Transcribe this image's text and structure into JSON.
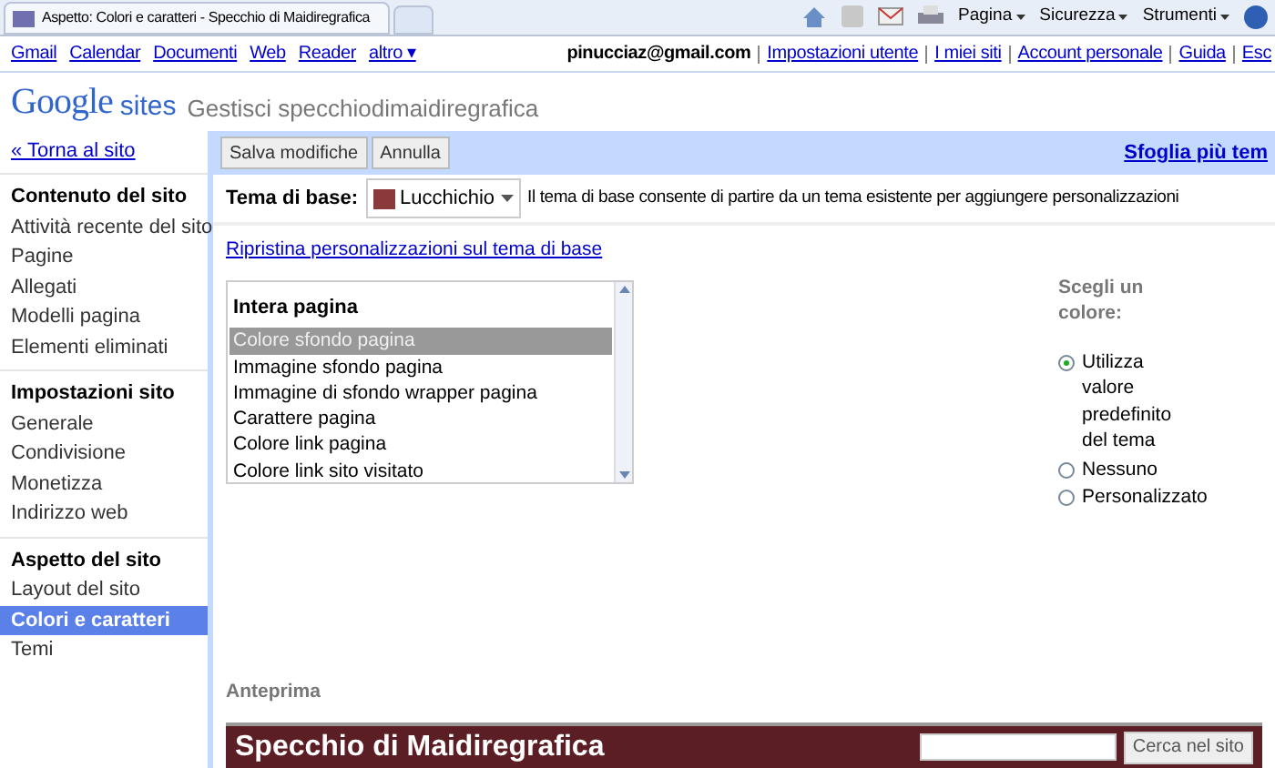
{
  "browser": {
    "tab_title": "Aspetto: Colori e caratteri - Specchio di Maidiregrafica",
    "commands": [
      "Pagina",
      "Sicurezza",
      "Strumenti"
    ]
  },
  "google_bar": {
    "links": [
      "Gmail",
      "Calendar",
      "Documenti",
      "Web",
      "Reader",
      "altro ▾"
    ],
    "user": "pinucciaz@gmail.com",
    "account_links": [
      "Impostazioni utente",
      "I miei siti",
      "Account personale",
      "Guida",
      "Esc"
    ]
  },
  "header": {
    "logo": "Google",
    "product": "sites",
    "title": "Gestisci specchiodimaidiregrafica"
  },
  "sidebar": {
    "back_link": "« Torna al sito",
    "sections": [
      {
        "heading": "Contenuto del sito",
        "items": [
          {
            "label": "Attività recente del sito",
            "selected": false
          },
          {
            "label": "Pagine",
            "selected": false
          },
          {
            "label": "Allegati",
            "selected": false
          },
          {
            "label": "Modelli pagina",
            "selected": false
          },
          {
            "label": "Elementi eliminati",
            "selected": false
          }
        ]
      },
      {
        "heading": "Impostazioni sito",
        "items": [
          {
            "label": "Generale",
            "selected": false
          },
          {
            "label": "Condivisione",
            "selected": false
          },
          {
            "label": "Monetizza",
            "selected": false
          },
          {
            "label": "Indirizzo web",
            "selected": false
          }
        ]
      },
      {
        "heading": "Aspetto del sito",
        "items": [
          {
            "label": "Layout del sito",
            "selected": false
          },
          {
            "label": "Colori e caratteri",
            "selected": true
          },
          {
            "label": "Temi",
            "selected": false
          }
        ]
      }
    ]
  },
  "toolbar": {
    "buttons": [
      "Salva modifiche",
      "Annulla"
    ],
    "browse_link": "Sfoglia più tem"
  },
  "theme": {
    "label": "Tema di base:",
    "value": "Lucchichio",
    "description": "Il tema di base consente di partire da un tema esistente per aggiungere personalizzazioni",
    "reset_link": "Ripristina personalizzazioni sul tema di base"
  },
  "element_list": {
    "heading": "Intera pagina",
    "items": [
      {
        "label": "Colore sfondo pagina",
        "selected": true
      },
      {
        "label": "Immagine sfondo pagina",
        "selected": false
      },
      {
        "label": "Immagine di sfondo wrapper pagina",
        "selected": false
      },
      {
        "label": "Carattere pagina",
        "selected": false
      },
      {
        "label": "Colore link pagina",
        "selected": false
      },
      {
        "label": "Colore link sito visitato",
        "selected": false
      }
    ]
  },
  "color_picker": {
    "heading": "Scegli un colore:",
    "options": [
      {
        "label": "Utilizza valore predefinito del tema",
        "selected": true
      },
      {
        "label": "Nessuno",
        "selected": false
      },
      {
        "label": "Personalizzato",
        "selected": false
      }
    ]
  },
  "preview": {
    "label": "Anteprima",
    "site_title": "Specchio di Maidiregrafica",
    "search_button": "Cerca nel sito"
  }
}
